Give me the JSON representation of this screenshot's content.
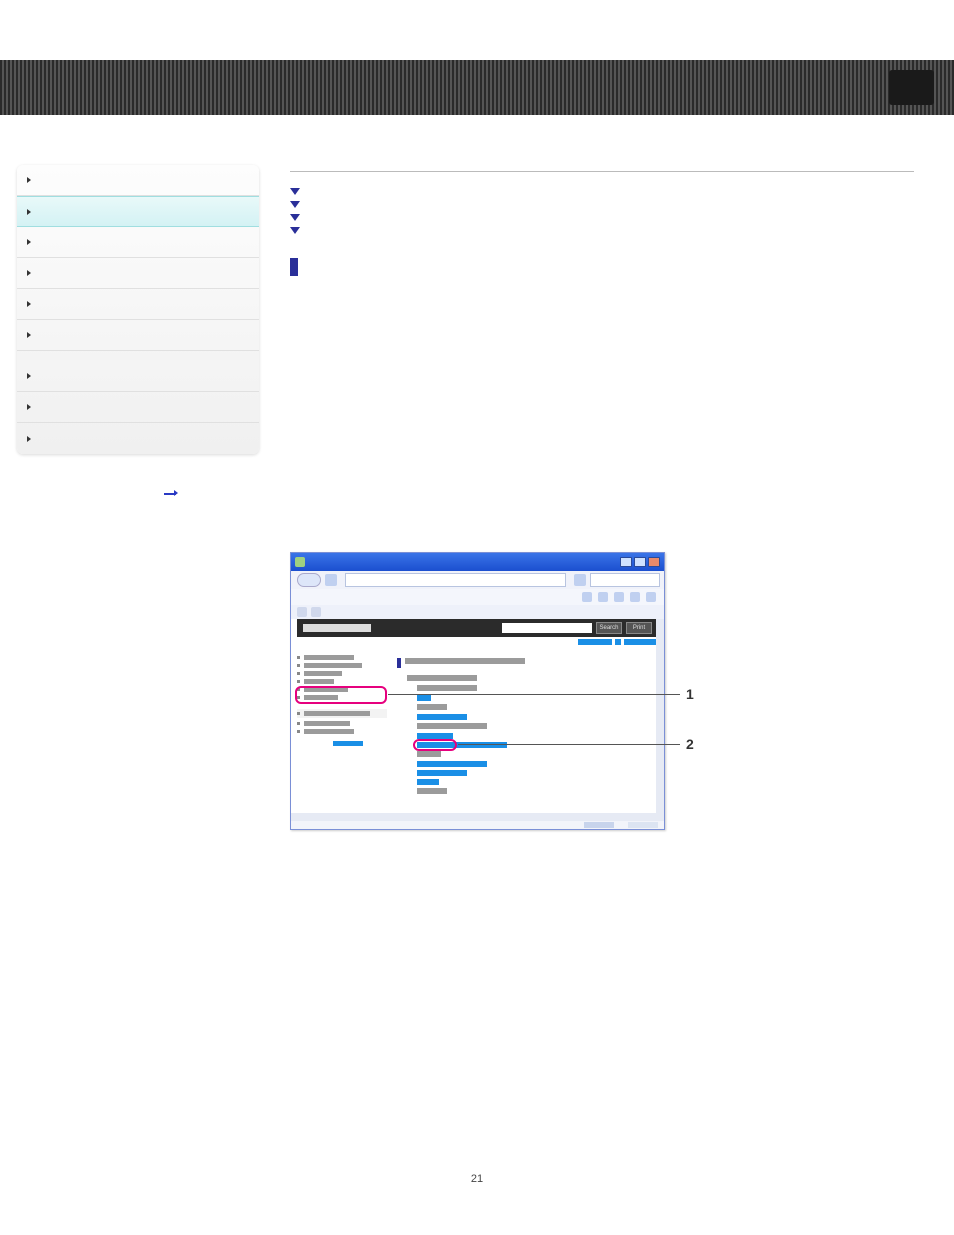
{
  "sidebar": {
    "items": [
      {
        "label": ""
      },
      {
        "label": ""
      },
      {
        "label": ""
      },
      {
        "label": ""
      },
      {
        "label": ""
      },
      {
        "label": ""
      },
      {
        "label": ""
      },
      {
        "label": ""
      },
      {
        "label": ""
      }
    ]
  },
  "content": {
    "section_title": "",
    "bullets": [
      "",
      "",
      "",
      ""
    ],
    "intro": "",
    "step_label": "",
    "step_desc": ""
  },
  "callouts": {
    "one": "1",
    "two": "2"
  },
  "screenshot": {
    "search_btn": "Search",
    "print_btn": "Print"
  },
  "page_number": "21"
}
